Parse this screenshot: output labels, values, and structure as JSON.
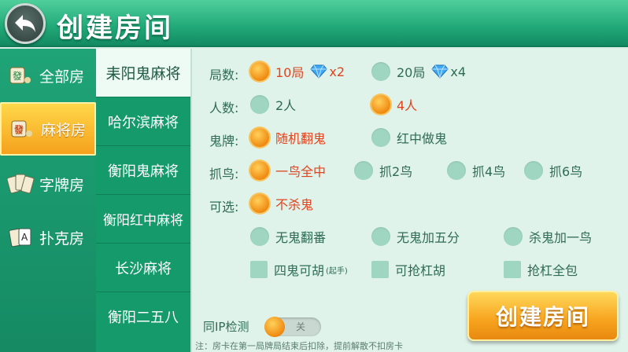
{
  "header": {
    "title": "创建房间"
  },
  "sidebar": {
    "items": [
      {
        "label": "全部房",
        "icon": "mahjong-tile-icon"
      },
      {
        "label": "麻将房",
        "icon": "mahjong-tile-icon"
      },
      {
        "label": "字牌房",
        "icon": "word-cards-icon"
      },
      {
        "label": "扑克房",
        "icon": "poker-cards-icon"
      }
    ],
    "active_index": 1
  },
  "games": {
    "items": [
      "耒阳鬼麻将",
      "哈尔滨麻将",
      "衡阳鬼麻将",
      "衡阳红中麻将",
      "长沙麻将",
      "衡阳二五八"
    ],
    "active_index": 0
  },
  "options": {
    "rounds": {
      "label": "局数:",
      "choices": [
        {
          "text": "10局",
          "mult": "x2",
          "selected": true
        },
        {
          "text": "20局",
          "mult": "x4",
          "selected": false
        }
      ]
    },
    "players": {
      "label": "人数:",
      "choices": [
        {
          "text": "2人",
          "selected": false
        },
        {
          "text": "4人",
          "selected": true
        }
      ]
    },
    "ghost": {
      "label": "鬼牌:",
      "choices": [
        {
          "text": "随机翻鬼",
          "selected": true
        },
        {
          "text": "红中做鬼",
          "selected": false
        }
      ]
    },
    "bird": {
      "label": "抓鸟:",
      "choices": [
        {
          "text": "一鸟全中",
          "selected": true
        },
        {
          "text": "抓2鸟",
          "selected": false
        },
        {
          "text": "抓4鸟",
          "selected": false
        },
        {
          "text": "抓6鸟",
          "selected": false
        }
      ]
    },
    "optional": {
      "label": "可选:",
      "choices": [
        {
          "text": "不杀鬼",
          "selected": true
        },
        {
          "text": "无鬼翻番",
          "selected": false
        },
        {
          "text": "无鬼加五分",
          "selected": false
        },
        {
          "text": "杀鬼加一鸟",
          "selected": false
        }
      ]
    },
    "checks": [
      {
        "text": "四鬼可胡",
        "sub": "(起手)"
      },
      {
        "text": "可抢杠胡",
        "sub": ""
      },
      {
        "text": "抢杠全包",
        "sub": ""
      }
    ]
  },
  "ip_check": {
    "label": "同IP检测",
    "state": "关"
  },
  "create_button": "创建房间",
  "note": "注：房卡在第一局牌局结束后扣除，提前解散不扣房卡",
  "colors": {
    "accent": "#f7a31e",
    "selected_text": "#e0441e",
    "header": "#21a878"
  }
}
